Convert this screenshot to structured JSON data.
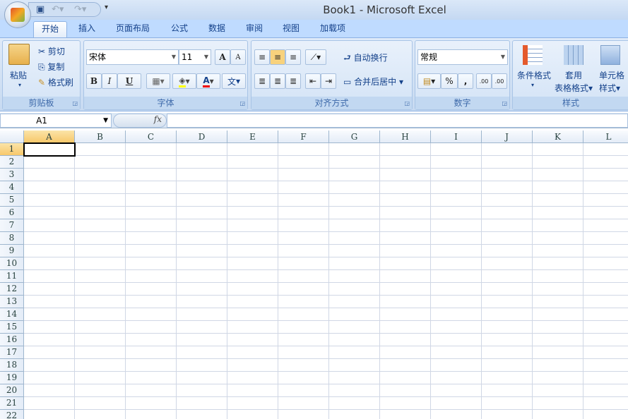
{
  "title": "Book1 - Microsoft Excel",
  "tabs": [
    "开始",
    "插入",
    "页面布局",
    "公式",
    "数据",
    "审阅",
    "视图",
    "加载项"
  ],
  "clipboard": {
    "paste": "粘贴",
    "cut": "剪切",
    "copy": "复制",
    "format_painter": "格式刷",
    "label": "剪贴板"
  },
  "font": {
    "name": "宋体",
    "size": "11",
    "bold": "B",
    "italic": "I",
    "underline": "U",
    "grow": "A",
    "shrink": "A",
    "color_a": "A",
    "phonetic": "文",
    "label": "字体"
  },
  "alignment": {
    "wrap": "自动换行",
    "merge": "合并后居中",
    "label": "对齐方式"
  },
  "number": {
    "format": "常规",
    "percent": "%",
    "comma": ",",
    "inc_decimal": ".00",
    "dec_decimal": ".00",
    "label": "数字"
  },
  "styles": {
    "conditional": "条件格式",
    "table1": "套用",
    "table2": "表格格式",
    "cell1": "单元格",
    "cell2": "样式",
    "label": "样式"
  },
  "formula_bar": {
    "name_box": "A1",
    "fx": "fx",
    "value": ""
  },
  "columns": [
    "A",
    "B",
    "C",
    "D",
    "E",
    "F",
    "G",
    "H",
    "I",
    "J",
    "K",
    "L"
  ],
  "rows": [
    "1",
    "2",
    "3",
    "4",
    "5",
    "6",
    "7",
    "8",
    "9",
    "10",
    "11",
    "12",
    "13",
    "14",
    "15",
    "16",
    "17",
    "18",
    "19",
    "20",
    "21",
    "22"
  ],
  "active_cell": "A1"
}
